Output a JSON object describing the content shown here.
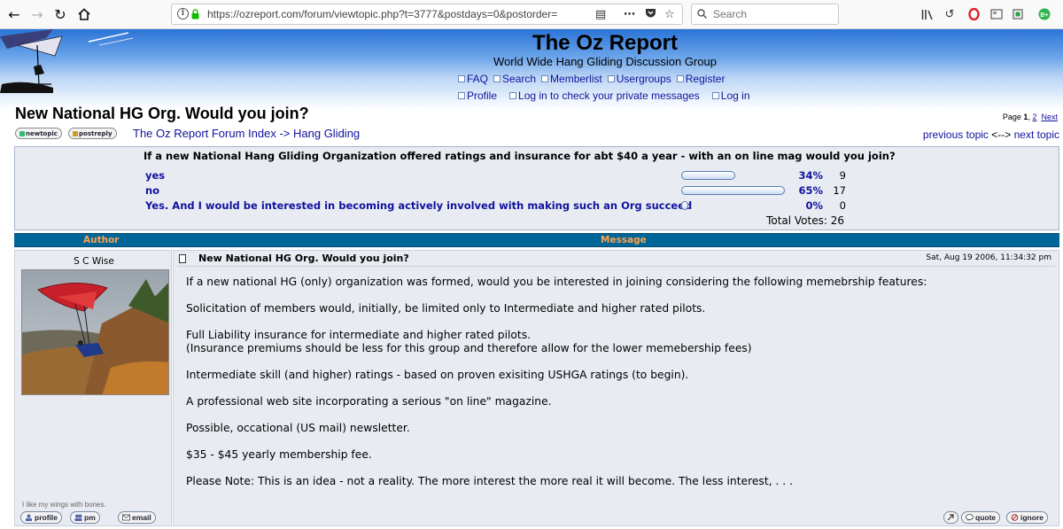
{
  "browser": {
    "url": "https://ozreport.com/forum/viewtopic.php?t=3777&postdays=0&postorder=",
    "search_placeholder": "Search"
  },
  "site": {
    "title": "The Oz Report",
    "subtitle": "World Wide Hang Gliding Discussion Group",
    "menu_row1": [
      "FAQ",
      "Search",
      "Memberlist",
      "Usergroups",
      "Register"
    ],
    "menu_row2": [
      "Profile",
      "Log in to check your private messages",
      "Log in"
    ]
  },
  "topic": {
    "title": "New National HG Org. Would you join?",
    "pager_prefix": "Page ",
    "pager_current": "1",
    "pager_sep": ", ",
    "pager_page2": "2",
    "pager_next": "Next",
    "new_topic_label": "newtopic",
    "post_reply_label": "postreply",
    "crumb_index": "The Oz Report Forum Index",
    "crumb_sep": " -> ",
    "crumb_forum": "Hang Gliding",
    "prev_topic": "previous topic",
    "topic_sep": " <--> ",
    "next_topic": "next topic"
  },
  "poll": {
    "question": "If a new National Hang Gliding Organization offered ratings and insurance for abt $40 a year - with an on line mag would you join?",
    "options": [
      {
        "label": "yes",
        "percent": "34%",
        "votes": "9",
        "fraction": 0.34
      },
      {
        "label": "no",
        "percent": "65%",
        "votes": "17",
        "fraction": 0.65
      },
      {
        "label": "Yes. And I would be interested in becoming actively involved with making such an Org succeed",
        "percent": "0%",
        "votes": "0",
        "fraction": 0
      }
    ],
    "total_label": "Total Votes: 26"
  },
  "thread": {
    "col_author": "Author",
    "col_message": "Message"
  },
  "post": {
    "author": "S C Wise",
    "subject": "New National HG Org. Would you join?",
    "date": "Sat, Aug 19 2006, 11:34:32 pm",
    "signature": "I like my wings with bones.",
    "body": [
      "If a new national HG (only) organization was formed, would you be interested in joining considering the following memebrship features:",
      "Solicitation of members would, initially, be limited only to Intermediate and higher rated pilots.",
      "Full Liability insurance for intermediate and higher rated pilots.",
      "(Insurance premiums should be less for this group and therefore allow for the lower memebership fees)",
      "Intermediate skill (and higher) ratings - based on proven exisiting USHGA ratings (to begin).",
      "A professional web site incorporating a serious \"on line\" magazine.",
      "Possible, occational (US mail) newsletter.",
      "$35 - $45 yearly membership fee.",
      "Please Note: This is an idea - not a reality. The more interest the more real it will become. The less interest, . . ."
    ],
    "btn_profile": "profile",
    "btn_pm": "pm",
    "btn_email": "email",
    "btn_quote": "quote",
    "btn_ignore": "ignore"
  }
}
